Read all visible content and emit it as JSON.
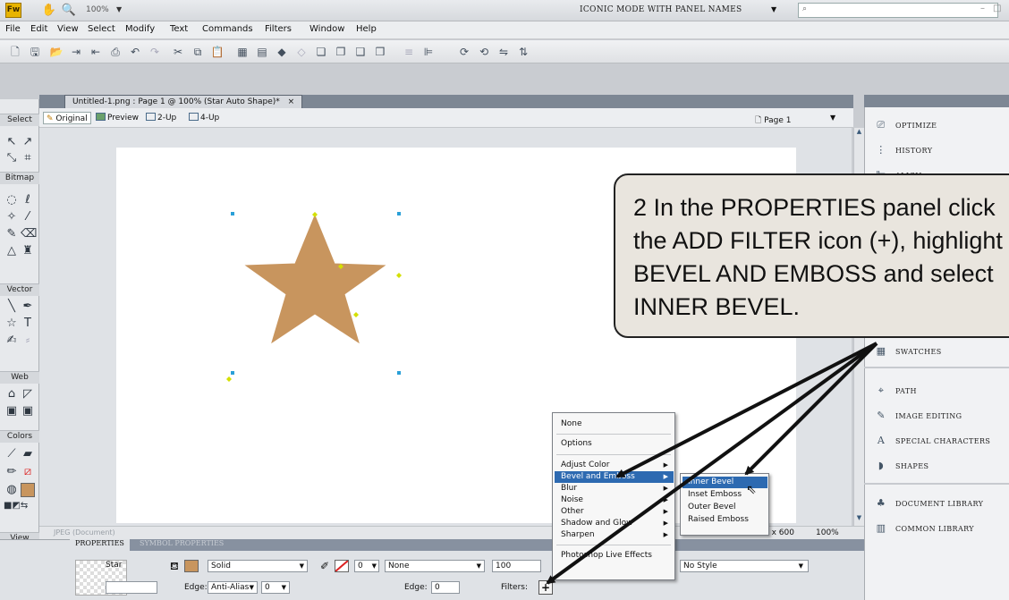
{
  "titlebar": {
    "logo": "Fw",
    "zoom": "100%",
    "mode": "ICONIC MODE WITH PANEL NAMES"
  },
  "menu": [
    "File",
    "Edit",
    "View",
    "Select",
    "Modify",
    "Text",
    "Commands",
    "Filters",
    "Window",
    "Help"
  ],
  "document": {
    "tab_title": "Untitled-1.png : Page 1 @ 100% (Star Auto Shape)*",
    "tab_close": "×",
    "views": [
      "Original",
      "Preview",
      "2-Up",
      "4-Up"
    ],
    "page_label": "Page 1",
    "dimensions": "0 x 600",
    "zoom": "100%",
    "status_left": "JPEG (Document)"
  },
  "tools": {
    "sections": [
      "Select",
      "Bitmap",
      "Vector",
      "Web",
      "Colors",
      "View"
    ]
  },
  "dock": {
    "items": [
      "OPTIMIZE",
      "HISTORY",
      "ALIGN",
      "SWATCHES",
      "PATH",
      "IMAGE EDITING",
      "SPECIAL CHARACTERS",
      "SHAPES",
      "DOCUMENT LIBRARY",
      "COMMON LIBRARY"
    ]
  },
  "properties": {
    "tabs": [
      "PROPERTIES",
      "SYMBOL PROPERTIES"
    ],
    "object_name": "Star",
    "fill_type": "Solid",
    "edge_label": "Edge:",
    "edge_value": "Anti-Alias",
    "edge_amount": "0",
    "stroke_size": "0",
    "stroke_type": "None",
    "edge2_label": "Edge:",
    "edge2_amount": "0",
    "opacity": "100",
    "filters_label": "Filters:",
    "add_filter": "+",
    "style": "No Style"
  },
  "filter_menu": {
    "items": [
      "None",
      "Options",
      "Adjust Color",
      "Bevel and Emboss",
      "Blur",
      "Noise",
      "Other",
      "Shadow and Glow",
      "Sharpen",
      "Photoshop Live Effects"
    ],
    "selected": "Bevel and Emboss"
  },
  "submenu": {
    "items": [
      "Inner Bevel",
      "Inset Emboss",
      "Outer Bevel",
      "Raised Emboss"
    ],
    "selected": "Inner Bevel"
  },
  "callout": {
    "text": "2 In the PROPERTIES panel click the ADD FILTER icon (+), highlight BEVEL AND EMBOSS and select INNER BEVEL."
  },
  "colors": {
    "star_fill": "#c8955e",
    "menu_highlight": "#2d6ab1",
    "callout_bg": "#e9e5de"
  }
}
